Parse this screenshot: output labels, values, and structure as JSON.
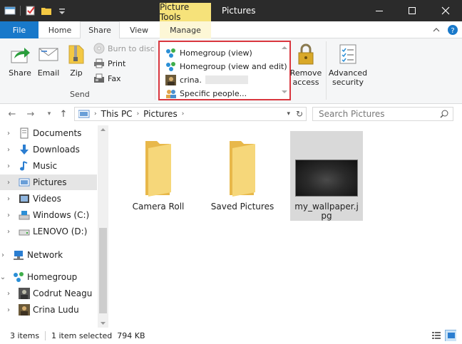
{
  "titlebar": {
    "context_tab": "Picture Tools",
    "title": "Pictures"
  },
  "ribbon_tabs": {
    "file": "File",
    "home": "Home",
    "share": "Share",
    "view": "View",
    "manage": "Manage"
  },
  "ribbon": {
    "share_label": "Share",
    "email_label": "Email",
    "zip_label": "Zip",
    "burn_label": "Burn to disc",
    "print_label": "Print",
    "fax_label": "Fax",
    "send_group": "Send",
    "share_with": [
      "Homegroup (view)",
      "Homegroup (view and edit)",
      "crina.",
      "Specific people..."
    ],
    "remove_access": [
      "Remove",
      "access"
    ],
    "advanced_security": [
      "Advanced",
      "security"
    ]
  },
  "address": {
    "segments": [
      "This PC",
      "Pictures"
    ],
    "search_placeholder": "Search Pictures"
  },
  "nav": {
    "items": [
      {
        "label": "Documents"
      },
      {
        "label": "Downloads"
      },
      {
        "label": "Music"
      },
      {
        "label": "Pictures"
      },
      {
        "label": "Videos"
      },
      {
        "label": "Windows (C:)"
      },
      {
        "label": "LENOVO (D:)"
      },
      {
        "label": "Network"
      },
      {
        "label": "Homegroup"
      },
      {
        "label": "Codrut Neagu"
      },
      {
        "label": "Crina Ludu"
      }
    ]
  },
  "files": [
    {
      "name": "Camera Roll"
    },
    {
      "name": "Saved Pictures"
    },
    {
      "name": "my_wallpaper.jpg"
    }
  ],
  "status": {
    "items": "3 items",
    "selected": "1 item selected  794 KB"
  },
  "colors": {
    "file_tab": "#1979ca",
    "context_tab": "#f6e27a",
    "highlight_border": "#d9363e",
    "titlebar": "#2b2b2b"
  }
}
